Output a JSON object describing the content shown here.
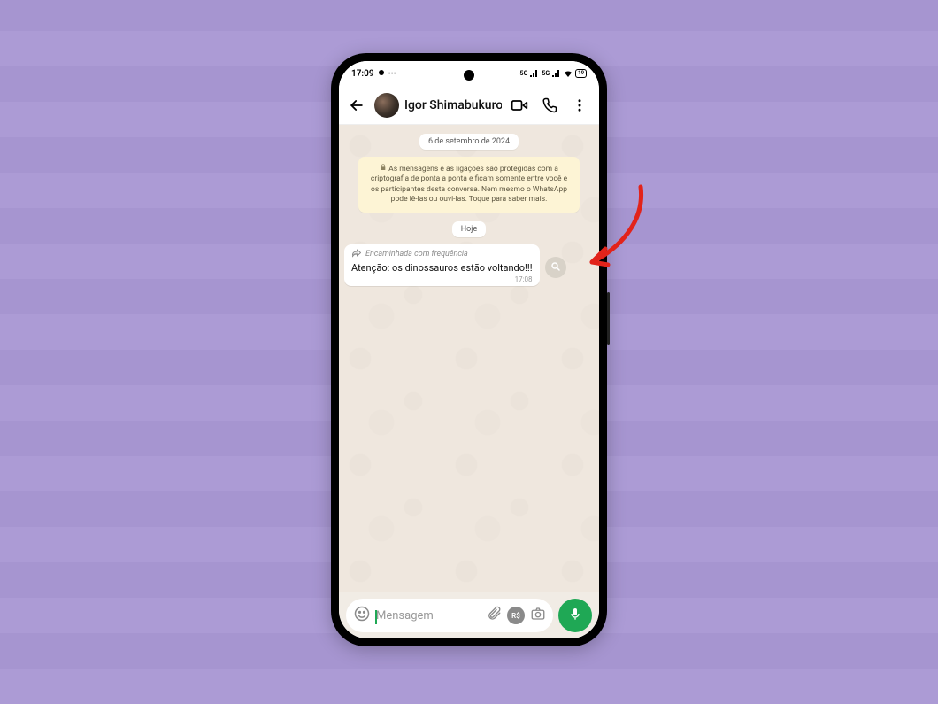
{
  "status": {
    "time": "17:09",
    "network_label": "5G",
    "battery_pct": "19"
  },
  "chat": {
    "contact_name": "Igor Shimabukuro",
    "date_chip_1": "6 de setembro de 2024",
    "encryption_notice": "As mensagens e as ligações são protegidas com a criptografia de ponta a ponta e ficam somente entre você e os participantes desta conversa. Nem mesmo o WhatsApp pode lê-las ou ouvi-las. Toque para saber mais.",
    "date_chip_2": "Hoje",
    "message": {
      "forwarded_label": "Encaminhada com frequência",
      "text": "Atenção: os dinossauros estão voltando!!!",
      "time": "17:08"
    },
    "input_placeholder": "Mensagem",
    "rs_label": "R$"
  }
}
